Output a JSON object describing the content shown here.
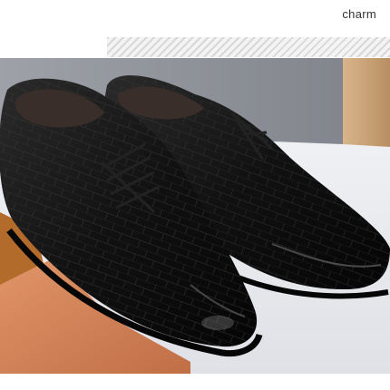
{
  "header": {
    "label": "charm"
  },
  "photo": {
    "subject": "pair-of-black-leather-oxford-shoes",
    "colors": {
      "wall": "#8f9299",
      "wood": "#c8a47a",
      "table": "#e9eaee",
      "rug": "#d4825a",
      "leather": "#141414"
    }
  }
}
